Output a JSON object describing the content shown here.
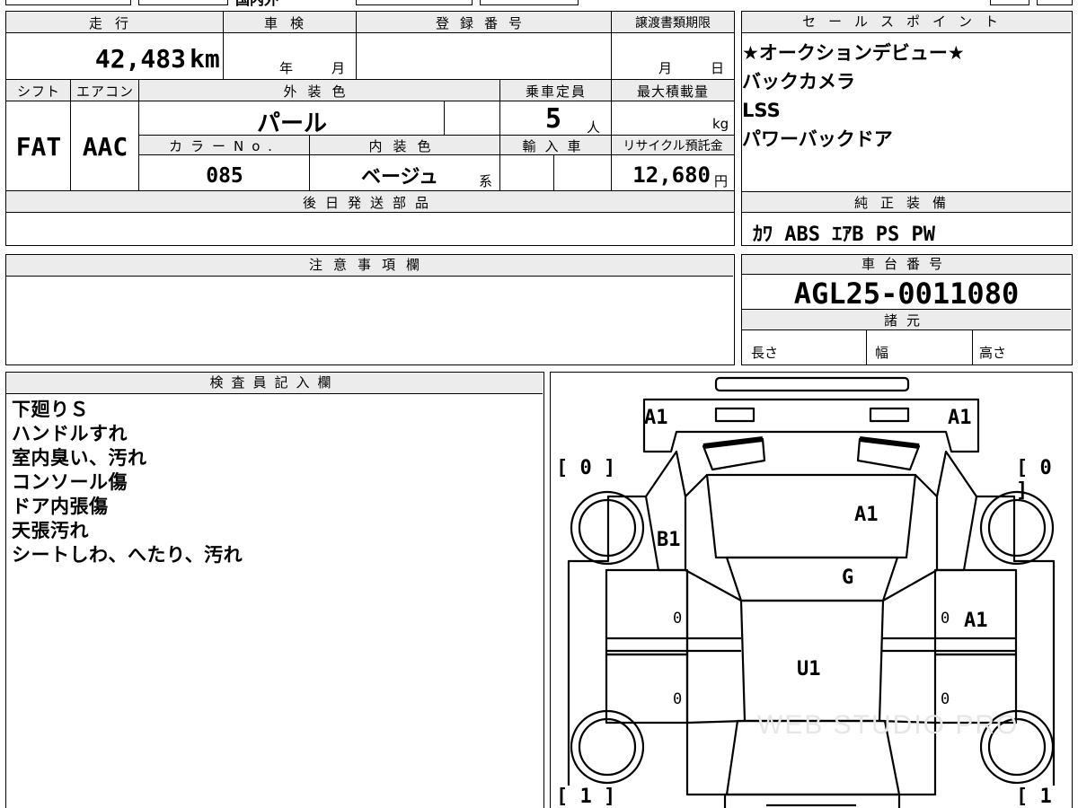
{
  "top_fragment": {
    "partial_text": "国内外"
  },
  "vehicle": {
    "mileage_label": "走行",
    "mileage_value": "42,483",
    "mileage_unit": "km",
    "inspection_label": "車検",
    "inspection_year": "年",
    "inspection_month": "月",
    "registration_label": "登録番号",
    "transfer_label": "譲渡書類期限",
    "transfer_month": "月",
    "transfer_day": "日",
    "shift_label": "シフト",
    "shift_value": "FAT",
    "aircon_label": "エアコン",
    "aircon_value": "AAC",
    "exterior_color_label": "外装色",
    "exterior_color_value": "パール",
    "capacity_label": "乗車定員",
    "capacity_value": "5",
    "capacity_unit": "人",
    "max_load_label": "最大積載量",
    "max_load_unit": "kg",
    "color_no_label": "カラーNo.",
    "color_no_value": "085",
    "interior_color_label": "内装色",
    "interior_color_value": "ベージュ",
    "interior_color_suffix": "系",
    "import_label": "輸入車",
    "recycle_label": "リサイクル預託金",
    "recycle_value": "12,680",
    "recycle_unit": "円",
    "later_parts_label": "後日発送部品"
  },
  "sales_points": {
    "header": "セールスポイント",
    "items": [
      "★オークションデビュー★",
      "バックカメラ",
      "LSS",
      "パワーバックドア"
    ]
  },
  "equipment": {
    "header": "純正装備",
    "value": "ｶﾜ ABS ｴｱB PS PW"
  },
  "caution": {
    "header": "注意事項欄"
  },
  "chassis": {
    "header": "車台番号",
    "value": "AGL25-0011080"
  },
  "specs": {
    "header": "諸元",
    "length_label": "長さ",
    "width_label": "幅",
    "height_label": "高さ"
  },
  "inspector": {
    "header": "検査員記入欄",
    "notes": [
      "下廻りＳ",
      "ハンドルすれ",
      "室内臭い、汚れ",
      "コンソール傷",
      "ドア内張傷",
      "天張汚れ",
      "シートしわ、へたり、汚れ"
    ]
  },
  "diagram": {
    "marks": {
      "front_left": "A1",
      "front_right": "A1",
      "bonnet": "A1",
      "fender_left": "B1",
      "windshield": "G",
      "rear_right_door": "A1",
      "roof": "U1",
      "door_fl": "0",
      "door_rl": "0",
      "door_fr": "0",
      "door_rr": "0"
    },
    "tire_front_left": "[ 0 ]",
    "tire_front_right": "[ 0 ]",
    "tire_rear_left": "[ 1 ]",
    "tire_rear_right": "[ 1 ]",
    "watermark": "WEB STUDIO PRO"
  }
}
